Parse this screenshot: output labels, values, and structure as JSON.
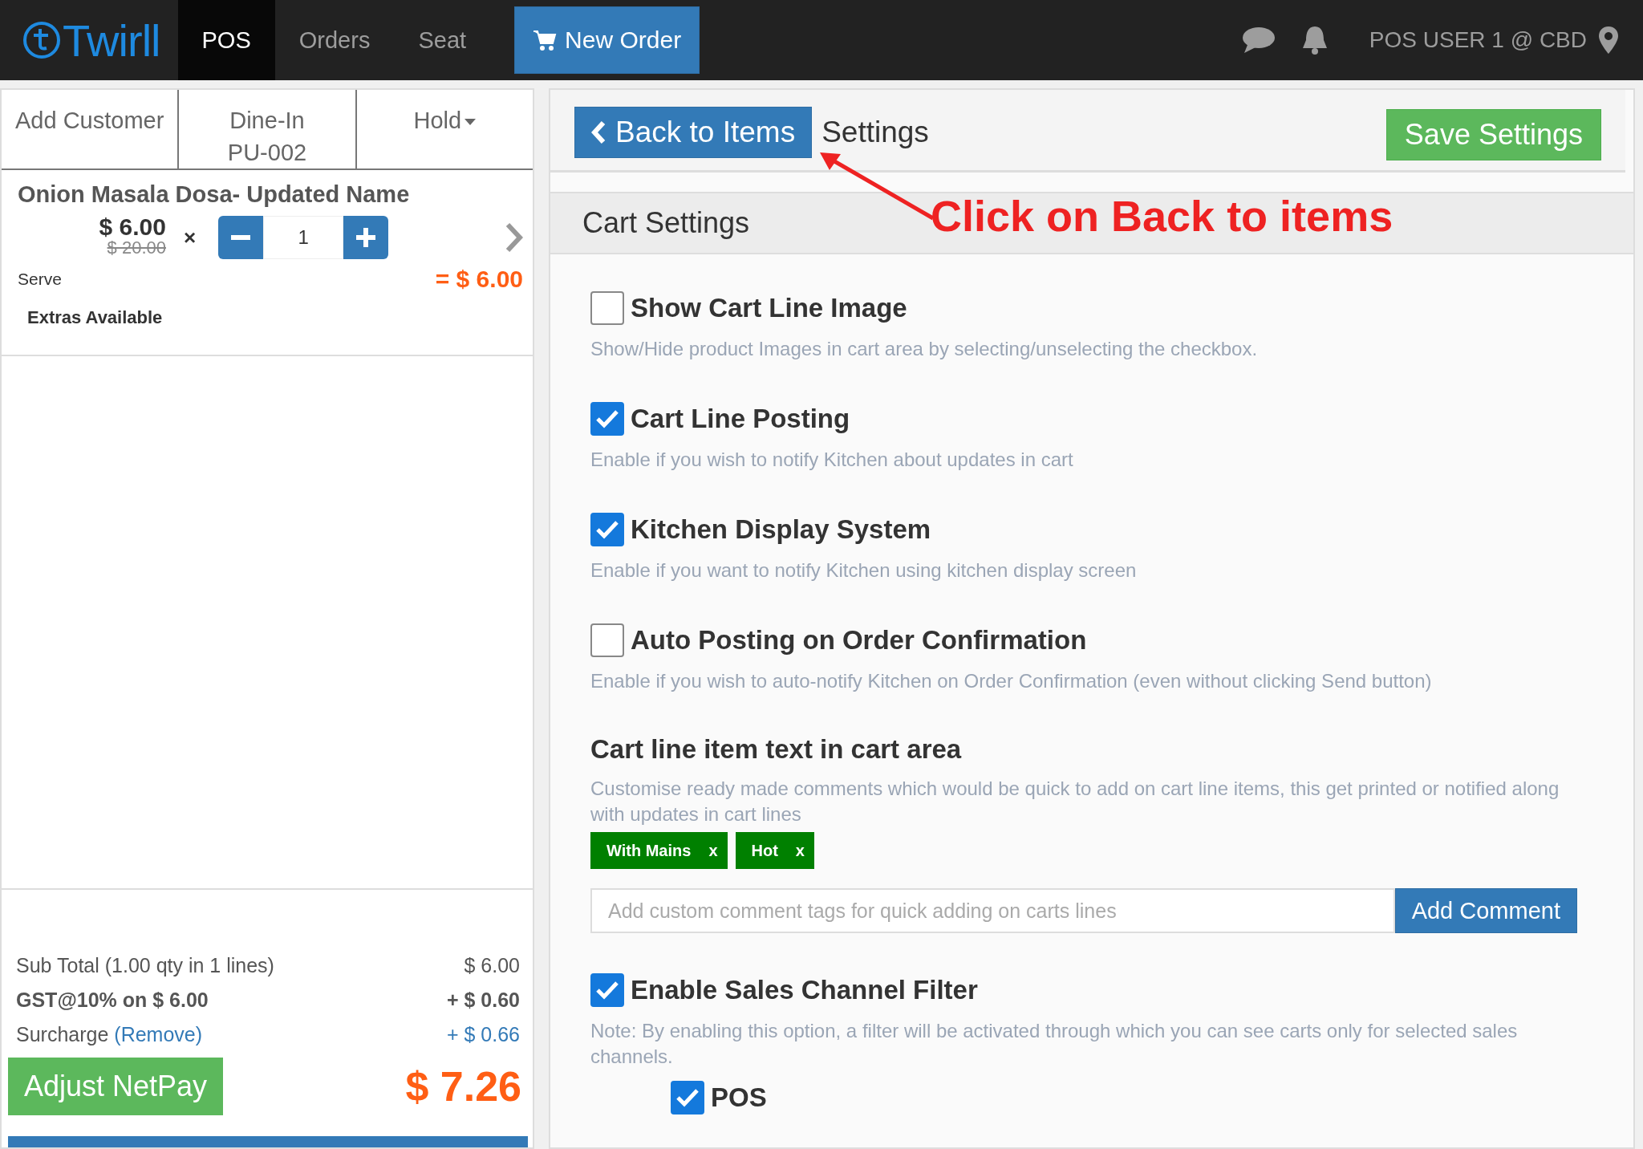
{
  "nav": {
    "logo": "Twirll",
    "tabs": [
      {
        "label": "POS",
        "selected": true
      },
      {
        "label": "Orders",
        "selected": false
      },
      {
        "label": "Seat",
        "selected": false
      }
    ],
    "new_order_button": "New Order",
    "user": "POS USER 1 @ CBD"
  },
  "cart": {
    "customer_button": "Add Customer",
    "order_type": {
      "label": "Dine-In",
      "code": "PU-002"
    },
    "hold_button": "Hold",
    "line": {
      "name": "Onion Masala Dosa- Updated Name",
      "price": "$ 6.00",
      "original_price": "$ 20.00",
      "times": "×",
      "quantity": "1",
      "serve": "Serve",
      "total": "= $ 6.00",
      "extras": "Extras Available"
    },
    "totals": {
      "subtotal_label": "Sub Total (1.00 qty in 1 lines)",
      "subtotal": "$ 6.00",
      "tax_label": "GST@10% on $ 6.00",
      "tax": "+ $ 0.60",
      "surcharge_label": "Surcharge",
      "surcharge_link": "(Remove)",
      "surcharge": "+ $ 0.66",
      "adjust_button": "Adjust NetPay",
      "net": "$ 7.26"
    }
  },
  "settings": {
    "back_button": "Back to Items",
    "title": "Settings",
    "save_button": "Save Settings",
    "section": "Cart Settings",
    "options": [
      {
        "kind": "checkbox",
        "title": "Show Cart Line Image",
        "description": "Show/Hide product Images in cart area by selecting/unselecting the checkbox.",
        "checked": false
      },
      {
        "kind": "checkbox",
        "title": "Cart Line Posting",
        "description": "Enable if you wish to notify Kitchen about updates in cart",
        "checked": true
      },
      {
        "kind": "checkbox",
        "title": "Kitchen Display System",
        "description": "Enable if you want to notify Kitchen using kitchen display screen",
        "checked": true
      },
      {
        "kind": "checkbox",
        "title": "Auto Posting on Order Confirmation",
        "description": "Enable if you wish to auto-notify Kitchen on Order Confirmation (even without clicking Send button)",
        "checked": false
      },
      {
        "kind": "comments",
        "title": "Cart line item text in cart area",
        "description": "Customise ready made comments which would be quick to add on cart line items, this get printed or notified along with updates in cart lines",
        "tags": [
          {
            "label": "With Mains",
            "remove": "x"
          },
          {
            "label": "Hot",
            "remove": "x"
          }
        ],
        "placeholder": "Add custom comment tags for quick adding on carts lines",
        "button": "Add Comment"
      },
      {
        "kind": "checkbox",
        "title": "Enable Sales Channel Filter",
        "description": "Note: By enabling this option, a filter will be activated through which you can see carts only for selected sales channels.",
        "checked": true,
        "channels": [
          {
            "label": "POS",
            "checked": true
          }
        ]
      }
    ]
  },
  "annotation": {
    "text": "Click on Back to items"
  }
}
